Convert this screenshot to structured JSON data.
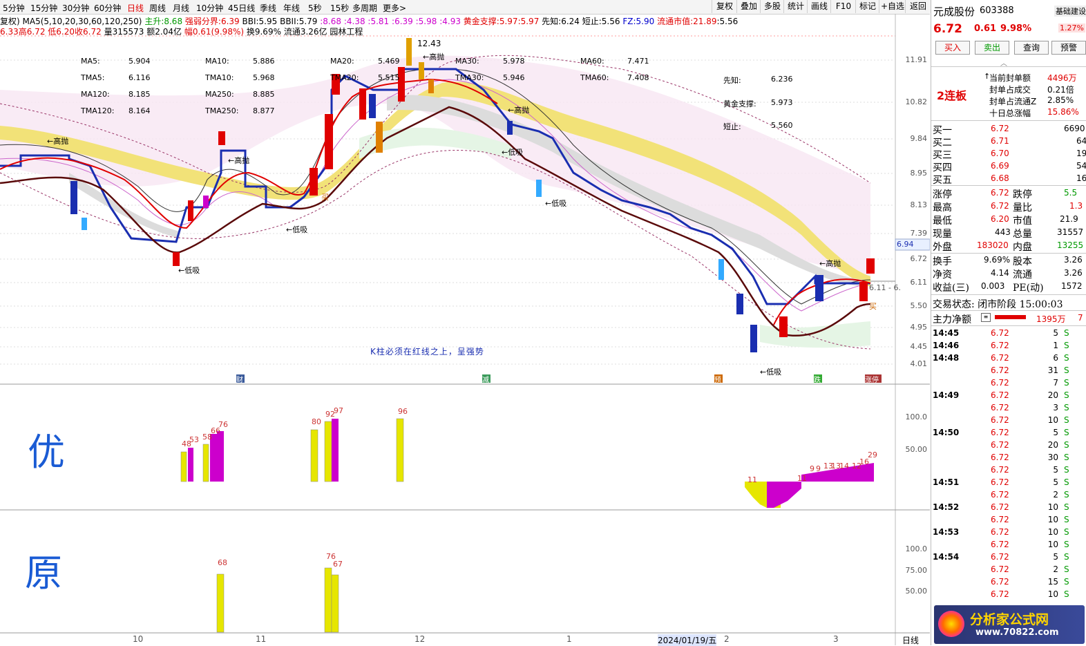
{
  "toolbar": {
    "timeframes": [
      "5分钟",
      "15分钟",
      "30分钟",
      "60分钟",
      "日线",
      "周线",
      "月线",
      "10分钟",
      "45日线",
      "季线",
      "年线",
      "5秒",
      "15秒",
      "多周期",
      "更多>"
    ],
    "active_timeframe": "日线",
    "buttons": [
      "复权",
      "叠加",
      "多股",
      "统计",
      "画线",
      "F10",
      "标记",
      "+自选",
      "返回"
    ]
  },
  "info_line1": {
    "fuquan": "复权)",
    "ma_params": "MA5(5,10,20,30,60,120,250)",
    "zhusheng_label": "主升:",
    "zhusheng_val": "8.68",
    "qiangruo_label": "强弱分界:",
    "qiangruo_val": "6.39",
    "bbi_label": "BBI:",
    "bbi_val": "5.95",
    "bbii_label": "BBII:",
    "bbii_val": "5.79",
    "seq1": "8.68",
    "seq2": "4.38",
    "seq3": "5.81",
    "seq4": "6.39",
    "seq5": "5.98",
    "seq6": "4.93",
    "gold_label": "黄金支撑:",
    "gold1": "5.97",
    "gold2": "5.97",
    "xianzhi_label": "先知:",
    "xianzhi_val": "6.24",
    "duanzhi_label": "短止:",
    "duanzhi_val": "5.56",
    "fz_label": "FZ:",
    "fz_val": "5.90",
    "liutong_label": "流通市值:",
    "liutong_val": "21.89",
    "liutong_val2": "5.56"
  },
  "info_line2": {
    "open": "6.33",
    "high_label": "高",
    "high": "6.72",
    "low_label": "低",
    "low": "6.20",
    "close_label": "收",
    "close": "6.72",
    "vol_label": "量",
    "vol": "315573",
    "amt_label": "额",
    "amt": "2.04亿",
    "chg_label": "幅",
    "chg": "0.61(9.98%)",
    "turnover": "换9.69%",
    "float": "流通3.26亿",
    "industry": "园林工程"
  },
  "ma_table": [
    [
      "MA5:",
      "5.904",
      "MA10:",
      "5.886",
      "MA20:",
      "5.469",
      "MA30:",
      "5.978",
      "MA60:",
      "7.471"
    ],
    [
      "TMA5:",
      "6.116",
      "TMA10:",
      "5.968",
      "TMA20:",
      "5.515",
      "TMA30:",
      "5.946",
      "TMA60:",
      "7.408"
    ],
    [
      "MA120:",
      "8.185",
      "MA250:",
      "8.885"
    ],
    [
      "TMA120:",
      "8.164",
      "TMA250:",
      "8.877"
    ]
  ],
  "signal_box": [
    {
      "label": "先知:",
      "value": "6.236"
    },
    {
      "label": "黄金支撑:",
      "value": "5.973"
    },
    {
      "label": "短止:",
      "value": "5.560"
    }
  ],
  "chart_note": "K柱必须在红线之上，呈强势",
  "price_axis": [
    "11.91",
    "10.82",
    "9.84",
    "8.95",
    "8.13",
    "7.39",
    "6.72",
    "6.11",
    "5.50",
    "4.95",
    "4.45",
    "4.01"
  ],
  "current_price_tag": "6.94",
  "range_tag": "6.11 - 6.",
  "high_price_label": "12.43",
  "event_tags": [
    "财",
    "减",
    "预",
    "跌",
    "涨停"
  ],
  "chart_tags": {
    "gaopao": "←高抛",
    "dixi": "←低吸",
    "mai": "买"
  },
  "panel2_axis": [
    "100.0",
    "50.00"
  ],
  "panel3_axis": [
    "100.0",
    "75.00",
    "50.00"
  ],
  "panel2_handwriting": "优",
  "panel3_handwriting": "原",
  "panel2_bars_labels": [
    "48",
    "53",
    "58",
    "66",
    "76",
    "80",
    "92",
    "97",
    "96",
    "11",
    "11",
    "9",
    "9",
    "13",
    "13",
    "14",
    "12",
    "16",
    "29"
  ],
  "panel3_bars_labels": [
    "68",
    "76",
    "67"
  ],
  "date_axis": [
    "10",
    "11",
    "12",
    "2024/01/19/五",
    "1",
    "2",
    "3"
  ],
  "date_axis_right": "日线",
  "stock": {
    "name": "元成股份",
    "code": "603388",
    "tag": "基础建设",
    "tag_pct": "1.27%",
    "price": "6.72",
    "change": "0.61",
    "change_pct": "9.98%",
    "actions": [
      "买入",
      "卖出",
      "查询",
      "预警"
    ],
    "lianban": "2连板",
    "seal_amount_label": "当前封单额",
    "seal_amount": "4496万",
    "seal_vol_label": "封单占成交",
    "seal_vol": "0.21倍",
    "seal_float_label": "封单占流通Z",
    "seal_float": "2.85%",
    "ten_day_label": "十日总涨幅",
    "ten_day": "15.86%"
  },
  "order_book": [
    {
      "label": "买一",
      "price": "6.72",
      "vol": "6690"
    },
    {
      "label": "买二",
      "price": "6.71",
      "vol": "64"
    },
    {
      "label": "买三",
      "price": "6.70",
      "vol": "19"
    },
    {
      "label": "买四",
      "price": "6.69",
      "vol": "54"
    },
    {
      "label": "买五",
      "price": "6.68",
      "vol": "16"
    }
  ],
  "quote_stats": [
    {
      "l1": "涨停",
      "v1": "6.72",
      "l2": "跌停",
      "v2": "5.5"
    },
    {
      "l1": "最高",
      "v1": "6.72",
      "l2": "量比",
      "v2": "1.3"
    },
    {
      "l1": "最低",
      "v1": "6.20",
      "l2": "市值",
      "v2": "21.9"
    },
    {
      "l1": "现量",
      "v1": "443",
      "l2": "总量",
      "v2": "31557"
    },
    {
      "l1": "外盘",
      "v1": "183020",
      "l2": "内盘",
      "v2": "13255"
    }
  ],
  "quote_stats2": [
    {
      "l1": "换手",
      "v1": "9.69%",
      "l2": "股本",
      "v2": "3.26"
    },
    {
      "l1": "净资",
      "v1": "4.14",
      "l2": "流通",
      "v2": "3.26"
    },
    {
      "l1": "收益(三)",
      "v1": "0.003",
      "l2": "PE(动)",
      "v2": "1572"
    }
  ],
  "trade_status": "交易状态: 闭市阶段 15:00:03",
  "main_flow_label": "主力净额",
  "main_flow_value": "1395万",
  "main_flow_extra": "7",
  "ticks": [
    {
      "t": "14:45",
      "p": "6.72",
      "v": "5",
      "s": "S"
    },
    {
      "t": "14:46",
      "p": "6.72",
      "v": "1",
      "s": "S"
    },
    {
      "t": "14:48",
      "p": "6.72",
      "v": "6",
      "s": "S"
    },
    {
      "t": "",
      "p": "6.72",
      "v": "31",
      "s": "S"
    },
    {
      "t": "",
      "p": "6.72",
      "v": "7",
      "s": "S"
    },
    {
      "t": "14:49",
      "p": "6.72",
      "v": "20",
      "s": "S"
    },
    {
      "t": "",
      "p": "6.72",
      "v": "3",
      "s": "S"
    },
    {
      "t": "",
      "p": "6.72",
      "v": "10",
      "s": "S"
    },
    {
      "t": "14:50",
      "p": "6.72",
      "v": "5",
      "s": "S"
    },
    {
      "t": "",
      "p": "6.72",
      "v": "20",
      "s": "S"
    },
    {
      "t": "",
      "p": "6.72",
      "v": "30",
      "s": "S"
    },
    {
      "t": "",
      "p": "6.72",
      "v": "5",
      "s": "S"
    },
    {
      "t": "14:51",
      "p": "6.72",
      "v": "5",
      "s": "S"
    },
    {
      "t": "",
      "p": "6.72",
      "v": "2",
      "s": "S"
    },
    {
      "t": "14:52",
      "p": "6.72",
      "v": "10",
      "s": "S"
    },
    {
      "t": "",
      "p": "6.72",
      "v": "10",
      "s": "S"
    },
    {
      "t": "14:53",
      "p": "6.72",
      "v": "10",
      "s": "S"
    },
    {
      "t": "",
      "p": "6.72",
      "v": "10",
      "s": "S"
    },
    {
      "t": "14:54",
      "p": "6.72",
      "v": "5",
      "s": "S"
    },
    {
      "t": "",
      "p": "6.72",
      "v": "2",
      "s": "S"
    },
    {
      "t": "",
      "p": "6.72",
      "v": "15",
      "s": "S"
    },
    {
      "t": "",
      "p": "6.72",
      "v": "10",
      "s": "S"
    }
  ],
  "watermark": {
    "line1": "分析家公式网",
    "line2": "www.70822.com"
  }
}
